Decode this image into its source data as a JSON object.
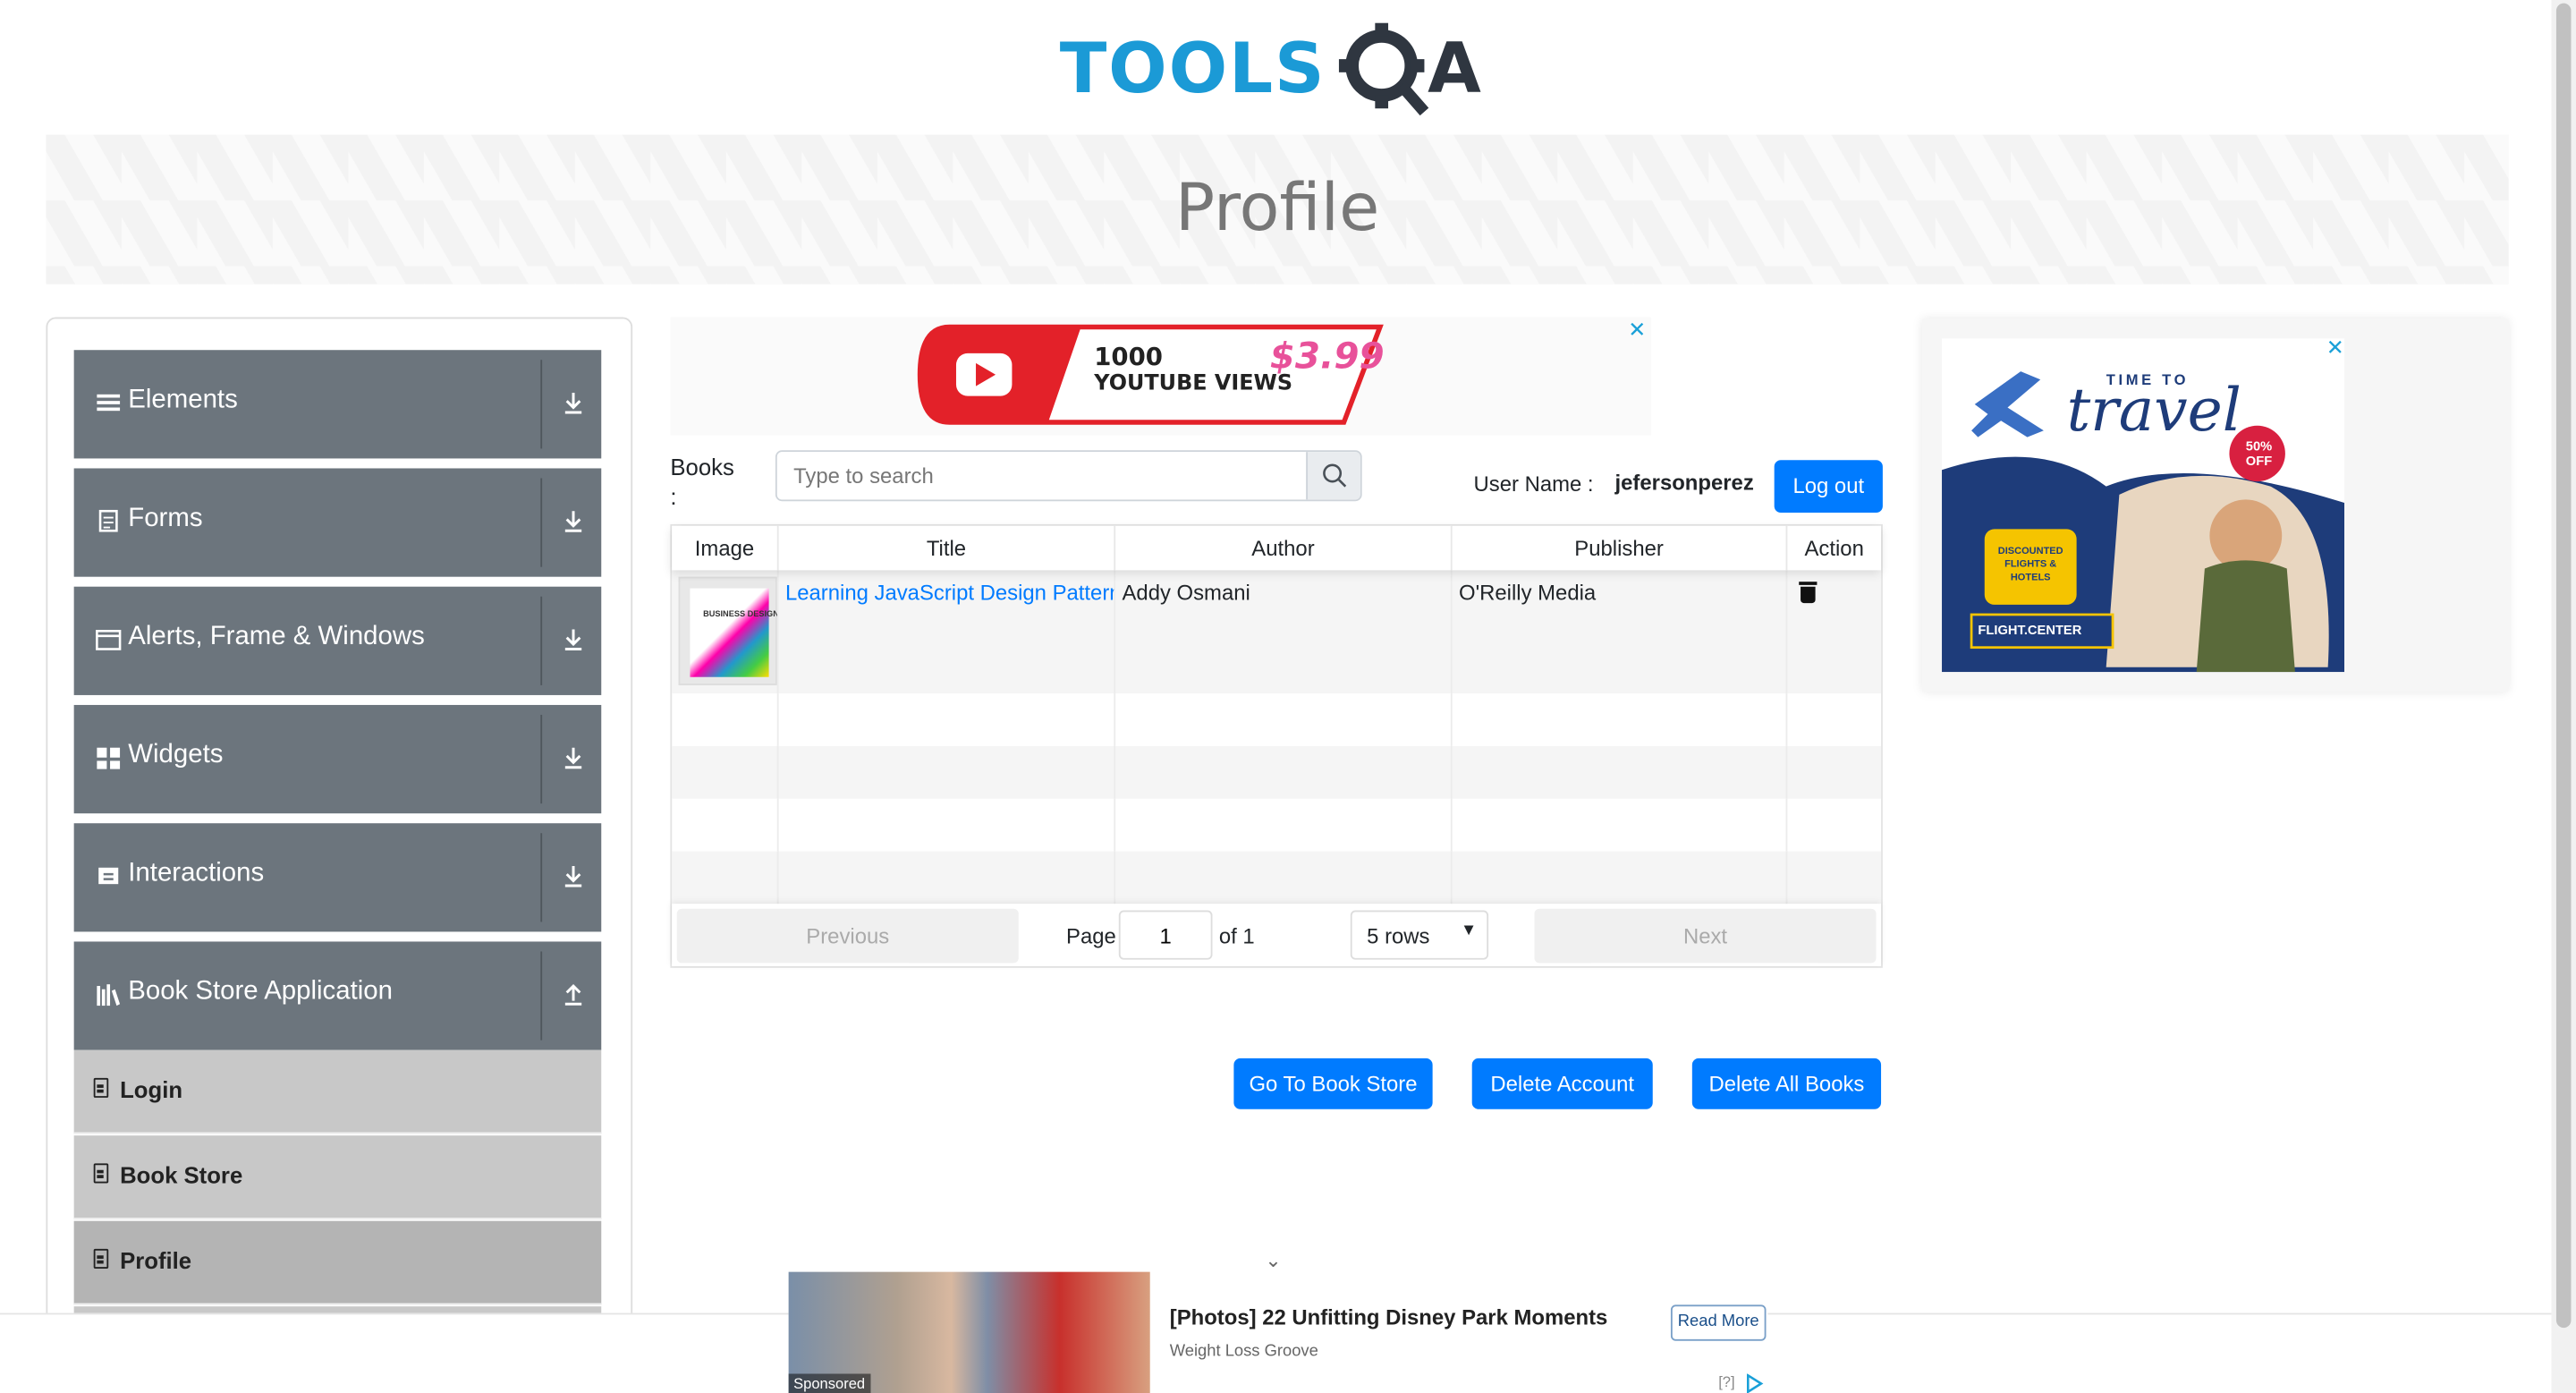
{
  "logo": {
    "brand": "TOOLSQA",
    "part1": "TOOLS",
    "part2": "QA"
  },
  "page_title": "Profile",
  "sidebar": {
    "groups": [
      {
        "label": "Elements",
        "icon": "list-icon"
      },
      {
        "label": "Forms",
        "icon": "form-icon"
      },
      {
        "label": "Alerts, Frame & Windows",
        "icon": "window-icon"
      },
      {
        "label": "Widgets",
        "icon": "widgets-icon"
      },
      {
        "label": "Interactions",
        "icon": "interactions-icon"
      },
      {
        "label": "Book Store Application",
        "icon": "books-icon"
      }
    ],
    "sub_items": [
      {
        "label": "Login"
      },
      {
        "label": "Book Store"
      },
      {
        "label": "Profile"
      }
    ]
  },
  "ad_top": {
    "headline": "1000",
    "subline": "YOUTUBE VIEWS",
    "price": "$3.99",
    "close": "✕"
  },
  "search": {
    "books_label": "Books :",
    "placeholder": "Type to search"
  },
  "user": {
    "label": "User Name :",
    "value": "jefersonperez",
    "logout": "Log out"
  },
  "table": {
    "headers": [
      "Image",
      "Title",
      "Author",
      "Publisher",
      "Action"
    ],
    "rows": [
      {
        "cover_text": "BUSINESS DESIGN",
        "title": "Learning JavaScript Design Patterns",
        "author": "Addy Osmani",
        "publisher": "O'Reilly Media"
      }
    ]
  },
  "pagination": {
    "previous": "Previous",
    "page_label": "Page",
    "page_value": "1",
    "of_label": "of 1",
    "rows_option": "5 rows",
    "next": "Next"
  },
  "actions": {
    "go_to_store": "Go To Book Store",
    "delete_account": "Delete Account",
    "delete_all": "Delete All Books"
  },
  "ad_right": {
    "line1": "TIME TO",
    "line2": "travel",
    "discount": "50% OFF",
    "badge": "DISCOUNTED FLIGHTS & HOTELS",
    "brand": "FLIGHT.CENTER",
    "close": "✕"
  },
  "sponsored": {
    "tag": "Sponsored",
    "title": "[Photos] 22 Unfitting Disney Park Moments",
    "source": "Weight Loss Groove",
    "read_more": "Read More",
    "info": "[?]"
  },
  "colors": {
    "primary": "#007bff",
    "sidebar_group": "#6c757d",
    "sidebar_sub": "#c8c8c8",
    "logo_blue": "#1b9ad6"
  }
}
